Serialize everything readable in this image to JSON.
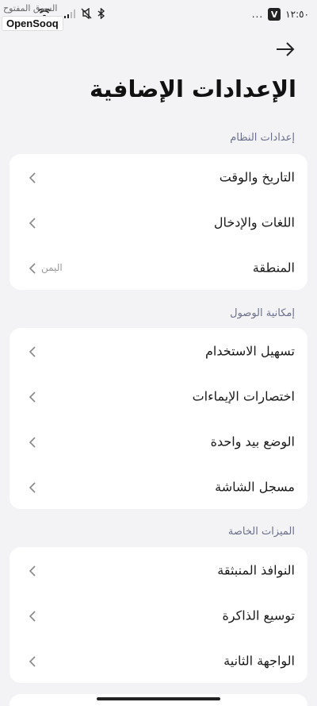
{
  "status_bar": {
    "time": "١٢:٥٠",
    "more": "...",
    "app_badge": "V"
  },
  "watermark": {
    "brand": "OpenSooq",
    "arabic": "السوق المفتوح"
  },
  "header": {
    "title": "الإعدادات الإضافية"
  },
  "sections": [
    {
      "title": "إعدادات النظام",
      "items": [
        {
          "label": "التاريخ والوقت",
          "value": ""
        },
        {
          "label": "اللغات والإدخال",
          "value": ""
        },
        {
          "label": "المنطقة",
          "value": "اليمن"
        }
      ]
    },
    {
      "title": "إمكانية الوصول",
      "items": [
        {
          "label": "تسهيل الاستخدام",
          "value": ""
        },
        {
          "label": "اختصارات الإيماءات",
          "value": ""
        },
        {
          "label": "الوضع بيد واحدة",
          "value": ""
        },
        {
          "label": "مسجل الشاشة",
          "value": ""
        }
      ]
    },
    {
      "title": "الميزات الخاصة",
      "items": [
        {
          "label": "النوافذ المنبثقة",
          "value": ""
        },
        {
          "label": "توسيع الذاكرة",
          "value": ""
        },
        {
          "label": "الواجهة الثانية",
          "value": ""
        }
      ]
    }
  ],
  "colors": {
    "background": "#f3f3f5",
    "card": "#ffffff",
    "section_header": "#6b6f8a",
    "text": "#1a1a1a",
    "secondary": "#999999"
  },
  "icons": [
    "wifi-icon",
    "signal-icon",
    "mute-icon",
    "bluetooth-icon",
    "back-arrow-icon",
    "chevron-left-icon"
  ]
}
